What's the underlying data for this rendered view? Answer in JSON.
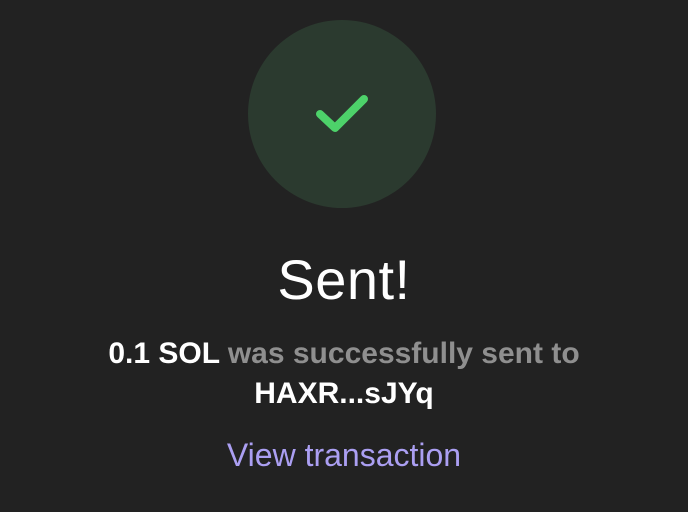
{
  "status": {
    "icon": "checkmark-icon",
    "circle_color": "#2b3a2f",
    "check_color": "#4dd26a"
  },
  "title": "Sent!",
  "message": {
    "amount": "0.1 SOL",
    "middle": " was successfully sent to",
    "recipient": "HAXR...sJYq"
  },
  "link": {
    "label": "View transaction",
    "color": "#ab9ff2"
  }
}
